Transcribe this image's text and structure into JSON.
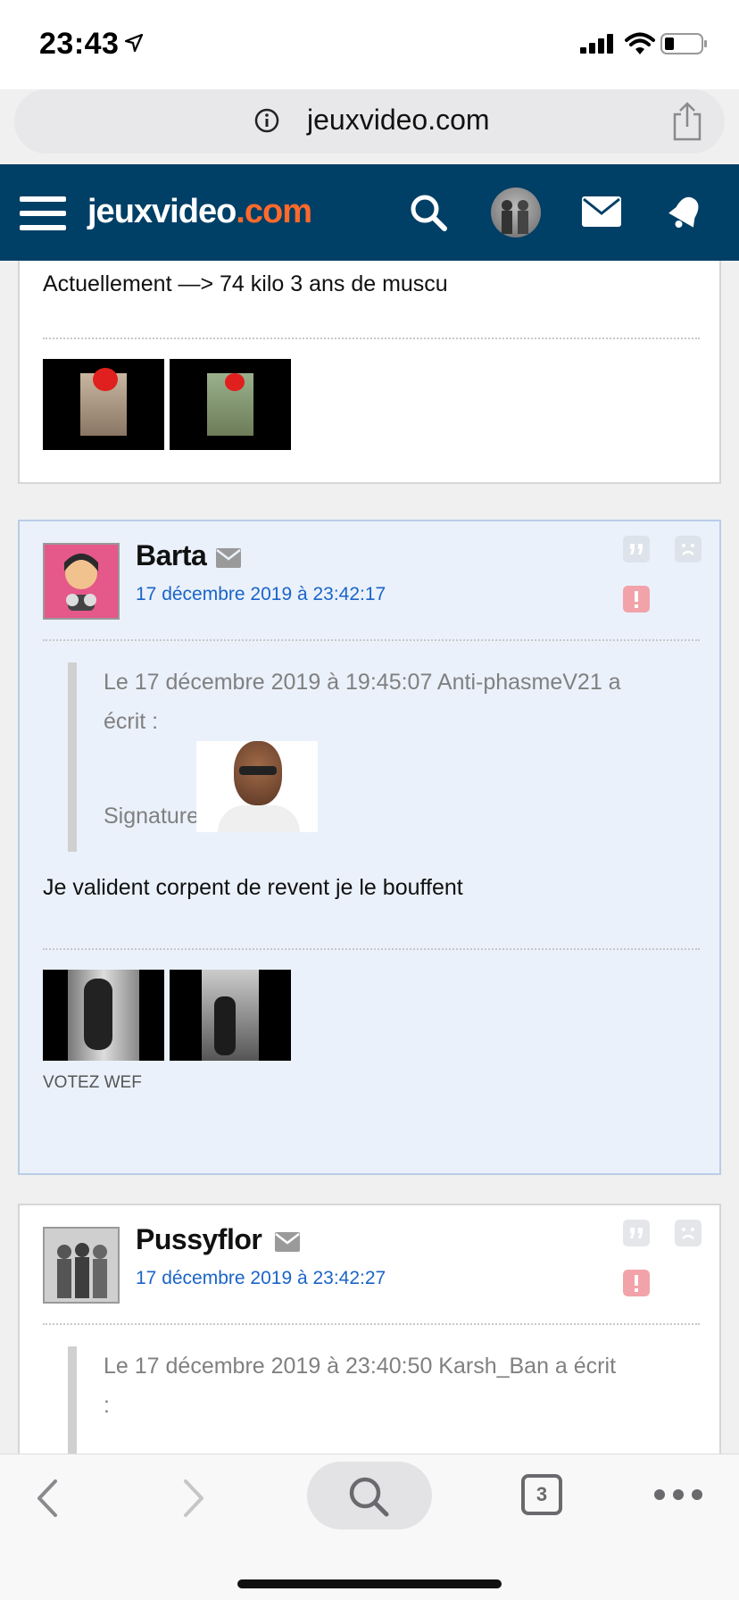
{
  "status_bar": {
    "time": "23:43"
  },
  "url_bar": {
    "domain": "jeuxvideo.com"
  },
  "site_header": {
    "logo_part1": "jeuxvideo",
    "logo_part2": ".com"
  },
  "posts": [
    {
      "text": "Actuellement —> 74 kilo 3 ans de muscu"
    },
    {
      "author": "Barta",
      "date": "17 décembre 2019 à 23:42:17",
      "quote_line1": "Le 17 décembre 2019 à 19:45:07 Anti-phasmeV21 a",
      "quote_line2": "écrit :",
      "quote_signature": "Signature",
      "text": "Je valident corpent de revent je le bouffent",
      "signature": "VOTEZ WEF"
    },
    {
      "author": "Pussyflor",
      "date": "17 décembre 2019 à 23:42:27",
      "quote_line1": "Le 17 décembre 2019 à 23:40:50 Karsh_Ban a écrit",
      "quote_line2": ":"
    }
  ],
  "tab_count": "3",
  "colors": {
    "nav_bg": "#003f66",
    "logo_accent": "#ff6a2b",
    "date_link": "#1a64c8",
    "alert_red": "#f2a3a9"
  }
}
